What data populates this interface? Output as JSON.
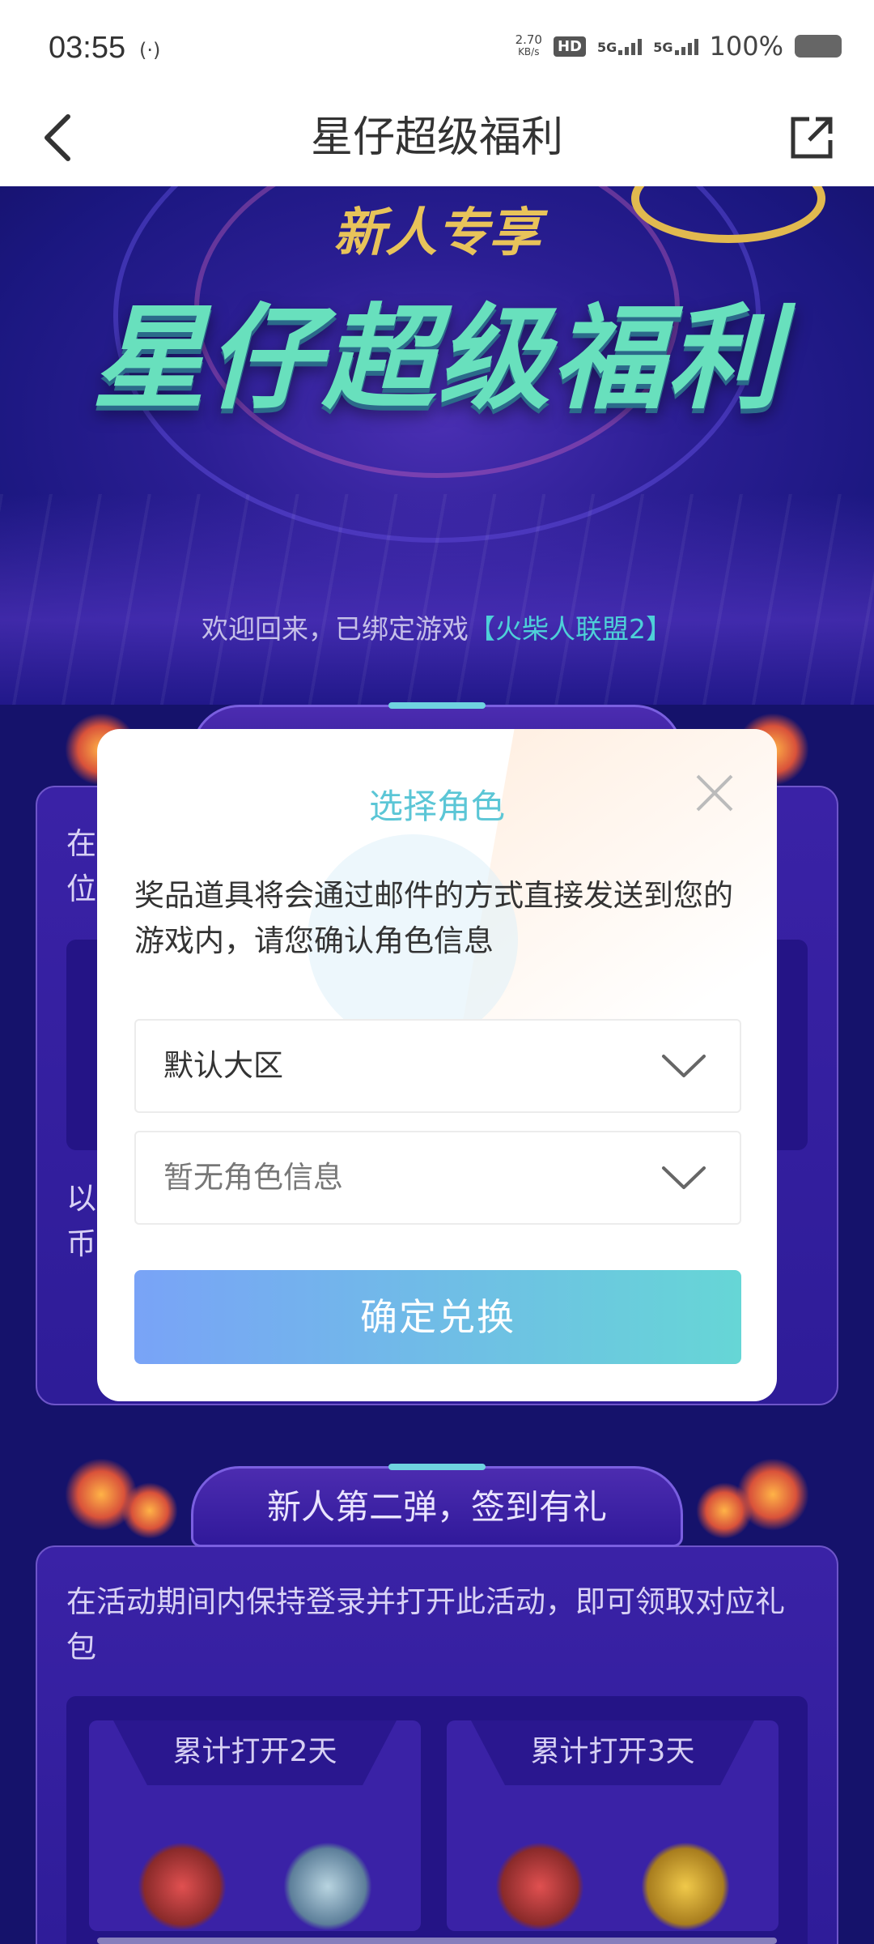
{
  "status_bar": {
    "time": "03:55",
    "net_speed_value": "2.70",
    "net_speed_unit": "KB/s",
    "hd_label": "HD",
    "sim1_label": "5G",
    "sim2_label": "5G",
    "battery_pct": "100%"
  },
  "nav": {
    "title": "星仔超级福利"
  },
  "hero": {
    "subtitle": "新人专享",
    "title": "星仔超级福利",
    "welcome_prefix": "欢迎回来，已绑定游戏",
    "welcome_game": "【火柴人联盟2】"
  },
  "card1": {
    "text_line1_visible": "在",
    "text_line2_visible": "位",
    "text_line3_visible": "以",
    "text_line4_visible": "币"
  },
  "card2": {
    "banner": "新人第二弹，签到有礼",
    "description": "在活动期间内保持登录并打开此活动，即可领取对应礼包",
    "rewards": [
      {
        "label": "累计打开2天"
      },
      {
        "label": "累计打开3天"
      }
    ]
  },
  "modal": {
    "title": "选择角色",
    "description": "奖品道具将会通过邮件的方式直接发送到您的游戏内，请您确认角色信息",
    "region_select_value": "默认大区",
    "role_select_placeholder": "暂无角色信息",
    "confirm_label": "确定兑换"
  },
  "colors": {
    "accent_teal": "#5bc6d6",
    "button_gradient_start": "#79a3f7",
    "button_gradient_end": "#66d6d6",
    "page_bg": "#15126b"
  }
}
